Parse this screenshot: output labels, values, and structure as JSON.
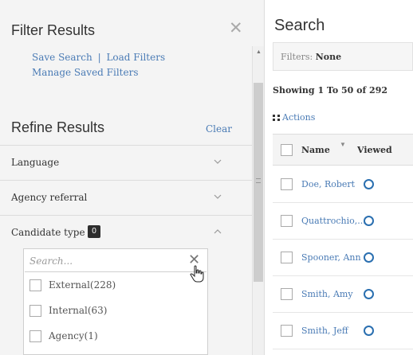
{
  "filter_panel": {
    "title": "Filter Results",
    "save_search": "Save Search",
    "separator": "|",
    "load_filters": "Load Filters",
    "manage_saved_filters": "Manage Saved Filters",
    "refine_title": "Refine Results",
    "clear_label": "Clear",
    "facets": [
      {
        "label": "Language",
        "expanded": false
      },
      {
        "label": "Agency referral",
        "expanded": false
      },
      {
        "label": "Candidate type",
        "expanded": true,
        "selected_count": "0"
      }
    ],
    "facet_search_placeholder": "Search...",
    "options": [
      {
        "label": "External(228)",
        "checked": false
      },
      {
        "label": "Internal(63)",
        "checked": false
      },
      {
        "label": "Agency(1)",
        "checked": false
      }
    ]
  },
  "main": {
    "title": "Search",
    "filters_key": "Filters:",
    "filters_value": "None",
    "showing": "Showing 1 To 50 of 292",
    "actions_label": "Actions",
    "columns": {
      "name": "Name",
      "viewed": "Viewed"
    },
    "rows": [
      {
        "name": "Doe, Robert"
      },
      {
        "name": "Quattrochio,..."
      },
      {
        "name": "Spooner, Ann"
      },
      {
        "name": "Smith, Amy"
      },
      {
        "name": "Smith, Jeff"
      }
    ]
  },
  "colors": {
    "link": "#4a7bb5",
    "panel_bg": "#f4f4f4",
    "viewed_icon": "#2a6fb0",
    "badge_bg": "#2e2e2e"
  }
}
